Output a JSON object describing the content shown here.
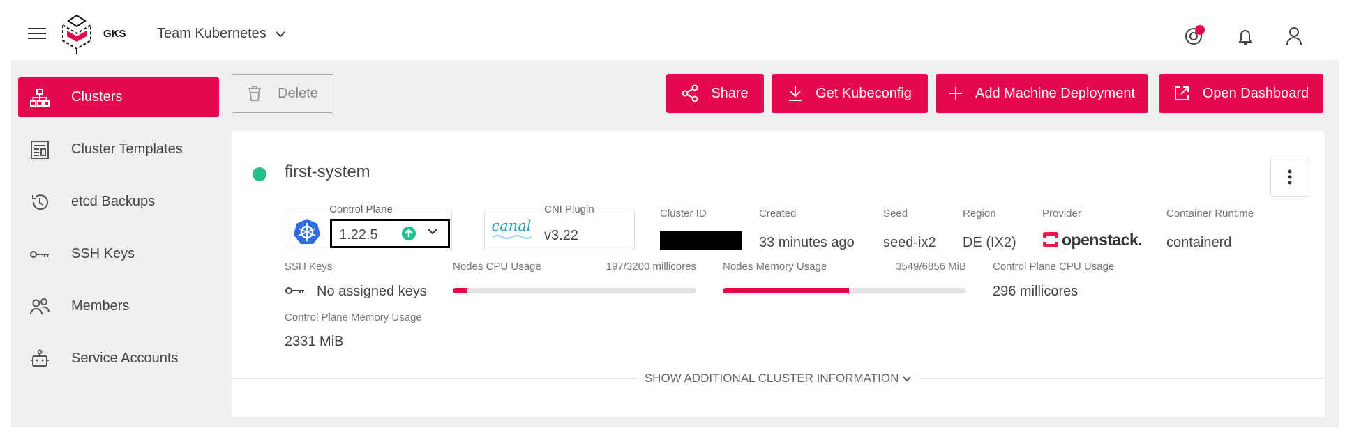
{
  "header": {
    "logo_text": "GKS",
    "team_name": "Team Kubernetes",
    "accent": "#e4084d"
  },
  "sidebar": {
    "items": [
      {
        "label": "Clusters",
        "icon": "sitemap-icon",
        "active": true
      },
      {
        "label": "Cluster Templates",
        "icon": "template-icon"
      },
      {
        "label": "etcd Backups",
        "icon": "history-icon"
      },
      {
        "label": "SSH Keys",
        "icon": "key-icon"
      },
      {
        "label": "Members",
        "icon": "members-icon"
      },
      {
        "label": "Service Accounts",
        "icon": "robot-icon"
      }
    ]
  },
  "toolbar": {
    "delete_label": "Delete",
    "share_label": "Share",
    "kubeconfig_label": "Get Kubeconfig",
    "add_md_label": "Add Machine Deployment",
    "dashboard_label": "Open Dashboard"
  },
  "cluster": {
    "name": "first-system",
    "status_color": "#22c08a",
    "control_plane_label": "Control Plane",
    "control_plane_version": "1.22.5",
    "cni_label": "CNI Plugin",
    "cni_logo_text": "canal",
    "cni_version": "v3.22",
    "cluster_id_label": "Cluster ID",
    "created_label": "Created",
    "created_value": "33 minutes ago",
    "seed_label": "Seed",
    "seed_value": "seed-ix2",
    "region_label": "Region",
    "region_value": "DE (IX2)",
    "provider_label": "Provider",
    "provider_value": "openstack.",
    "runtime_label": "Container Runtime",
    "runtime_value": "containerd",
    "ssh_label": "SSH Keys",
    "ssh_value": "No assigned keys",
    "cpu_label": "Nodes CPU Usage",
    "cpu_value": "197/3200 millicores",
    "cpu_fraction": 0.0616,
    "mem_label": "Nodes Memory Usage",
    "mem_value": "3549/6856 MiB",
    "mem_fraction": 0.5177,
    "cp_cpu_label": "Control Plane CPU Usage",
    "cp_cpu_value": "296 millicores",
    "cp_mem_label": "Control Plane Memory Usage",
    "cp_mem_value": "2331 MiB",
    "show_more_label": "SHOW ADDITIONAL CLUSTER INFORMATION"
  }
}
